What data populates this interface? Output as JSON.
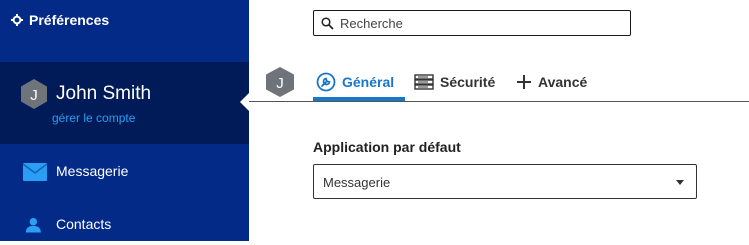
{
  "sidebar": {
    "title": "Préférences",
    "account": {
      "initial": "J",
      "name": "John Smith",
      "manage_link": "gérer le compte"
    },
    "items": [
      {
        "label": "Messagerie",
        "icon": "mail-icon"
      },
      {
        "label": "Contacts",
        "icon": "contacts-icon"
      }
    ]
  },
  "search": {
    "placeholder": "Recherche",
    "value": ""
  },
  "tabs": {
    "avatar_initial": "J",
    "items": [
      {
        "label": "Général",
        "icon": "wrench-icon",
        "active": true
      },
      {
        "label": "Sécurité",
        "icon": "server-icon",
        "active": false
      },
      {
        "label": "Avancé",
        "icon": "plus-icon",
        "active": false
      }
    ]
  },
  "general": {
    "default_app_label": "Application par défaut",
    "default_app_value": "Messagerie"
  },
  "colors": {
    "sidebar_bg": "#022a86",
    "account_bg": "#001b57",
    "accent": "#1877c9",
    "link": "#2a9df4",
    "avatar": "#6e7479"
  }
}
